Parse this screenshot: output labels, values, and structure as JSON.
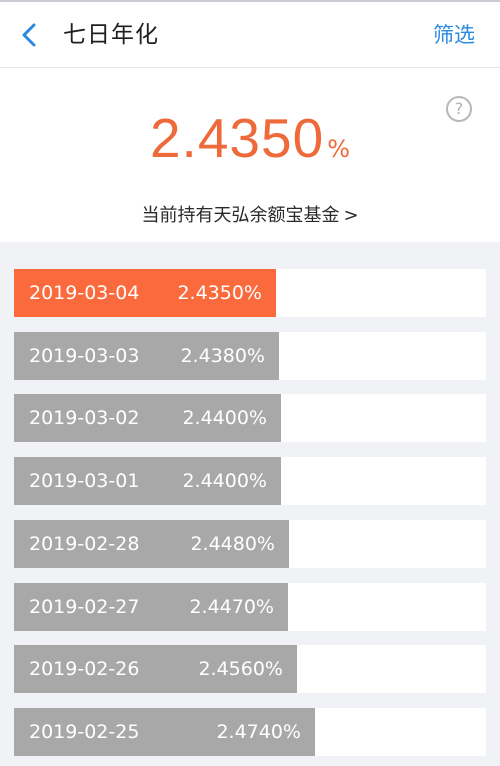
{
  "header": {
    "title": "七日年化",
    "filter_label": "筛选",
    "back_icon": "chevron-left-icon",
    "accent_color": "#2a8ae2"
  },
  "summary": {
    "rate_value": "2.4350",
    "rate_unit": "%",
    "help_icon": "question-circle-icon",
    "help_glyph": "?",
    "fund_link_label": "当前持有天弘余额宝基金",
    "fund_link_arrow": ">",
    "rate_color": "#ef6a3a"
  },
  "rates": [
    {
      "date": "2019-03-04",
      "rate": "2.4350%",
      "rate_value": 2.435,
      "active": true
    },
    {
      "date": "2019-03-03",
      "rate": "2.4380%",
      "rate_value": 2.438,
      "active": false
    },
    {
      "date": "2019-03-02",
      "rate": "2.4400%",
      "rate_value": 2.44,
      "active": false
    },
    {
      "date": "2019-03-01",
      "rate": "2.4400%",
      "rate_value": 2.44,
      "active": false
    },
    {
      "date": "2019-02-28",
      "rate": "2.4480%",
      "rate_value": 2.448,
      "active": false
    },
    {
      "date": "2019-02-27",
      "rate": "2.4470%",
      "rate_value": 2.447,
      "active": false
    },
    {
      "date": "2019-02-26",
      "rate": "2.4560%",
      "rate_value": 2.456,
      "active": false
    },
    {
      "date": "2019-02-25",
      "rate": "2.4740%",
      "rate_value": 2.474,
      "active": false
    }
  ],
  "colors": {
    "active_bar": "#fb6a3c",
    "inactive_bar": "#a8a8a8"
  }
}
